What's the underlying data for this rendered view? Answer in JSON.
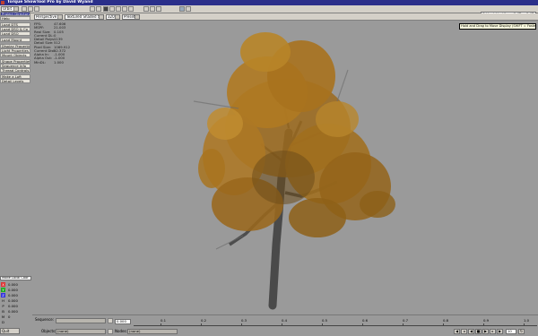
{
  "window": {
    "title": "Torque ShowTool Pro by David Wyand"
  },
  "toolbar": {
    "mode_select": "Orbit",
    "camera_select": "Perspective",
    "render_select": "Textured Shaded Solid",
    "resolution_select": "320x240",
    "presets_select": "Presets",
    "path": "C:/dev/object/trees/fallTree/fallTree.dts"
  },
  "left_panel": {
    "buttons": [
      "Project Directory",
      "Help",
      "Load DTS",
      "Load DSQ & Co",
      "Load DSQ",
      "Load Mount",
      "Display Properties",
      "Light Properties",
      "Mount Objects",
      "Shape Properties",
      "Sequence Info",
      "Thread Controls",
      "Make a Loft",
      "Detail Levels"
    ]
  },
  "stats": [
    {
      "k": "FPS:",
      "v": "47.606"
    },
    {
      "k": "MSPF:",
      "v": "21.003"
    },
    {
      "k": "Real Size:",
      "v": "0.105"
    },
    {
      "k": "Current DL:",
      "v": "0"
    },
    {
      "k": "Detail Polys:",
      "v": "1139"
    },
    {
      "k": "Detail Size:",
      "v": "512"
    },
    {
      "k": "Pixel Size:",
      "v": "1069.912"
    },
    {
      "k": "Current Dist:",
      "v": "52.372"
    },
    {
      "k": "Alpha In:",
      "v": "-1.000"
    },
    {
      "k": "Alpha Out:",
      "v": "-1.000"
    },
    {
      "k": "MinDL:",
      "v": "1.000"
    }
  ],
  "tooltip": "Hold and Drag to Move Display (SHIFT = Faster)",
  "transform": {
    "header": "Mode Local Coor",
    "rows": [
      {
        "label": "X",
        "value": "0.000"
      },
      {
        "label": "Y",
        "value": "0.000"
      },
      {
        "label": "Z",
        "value": "0.000"
      },
      {
        "label": "H",
        "value": "0.000"
      },
      {
        "label": "P",
        "value": "0.000"
      },
      {
        "label": "B",
        "value": "0.000"
      },
      {
        "label": "M",
        "value": "0"
      },
      {
        "label": "D",
        "value": ""
      }
    ]
  },
  "bottom": {
    "sequence_label": "Sequence:",
    "sequence_value": "",
    "objects_label": "Objects:",
    "objects_value": "(none)",
    "nodes_label": "Nodes:",
    "nodes_value": "(none)",
    "time_value": "0.000",
    "timeline_ticks": [
      "0.1",
      "0.2",
      "0.3",
      "0.4",
      "0.5",
      "0.6",
      "0.7",
      "0.8",
      "0.9",
      "1.0"
    ],
    "frame_value": "10"
  },
  "quit_label": "Quit",
  "colors": {
    "title_bar": "#2b2f8a",
    "viewport_bg": "#9a9a9a",
    "foliage": "#b07a22",
    "trunk": "#4a4a4a"
  }
}
